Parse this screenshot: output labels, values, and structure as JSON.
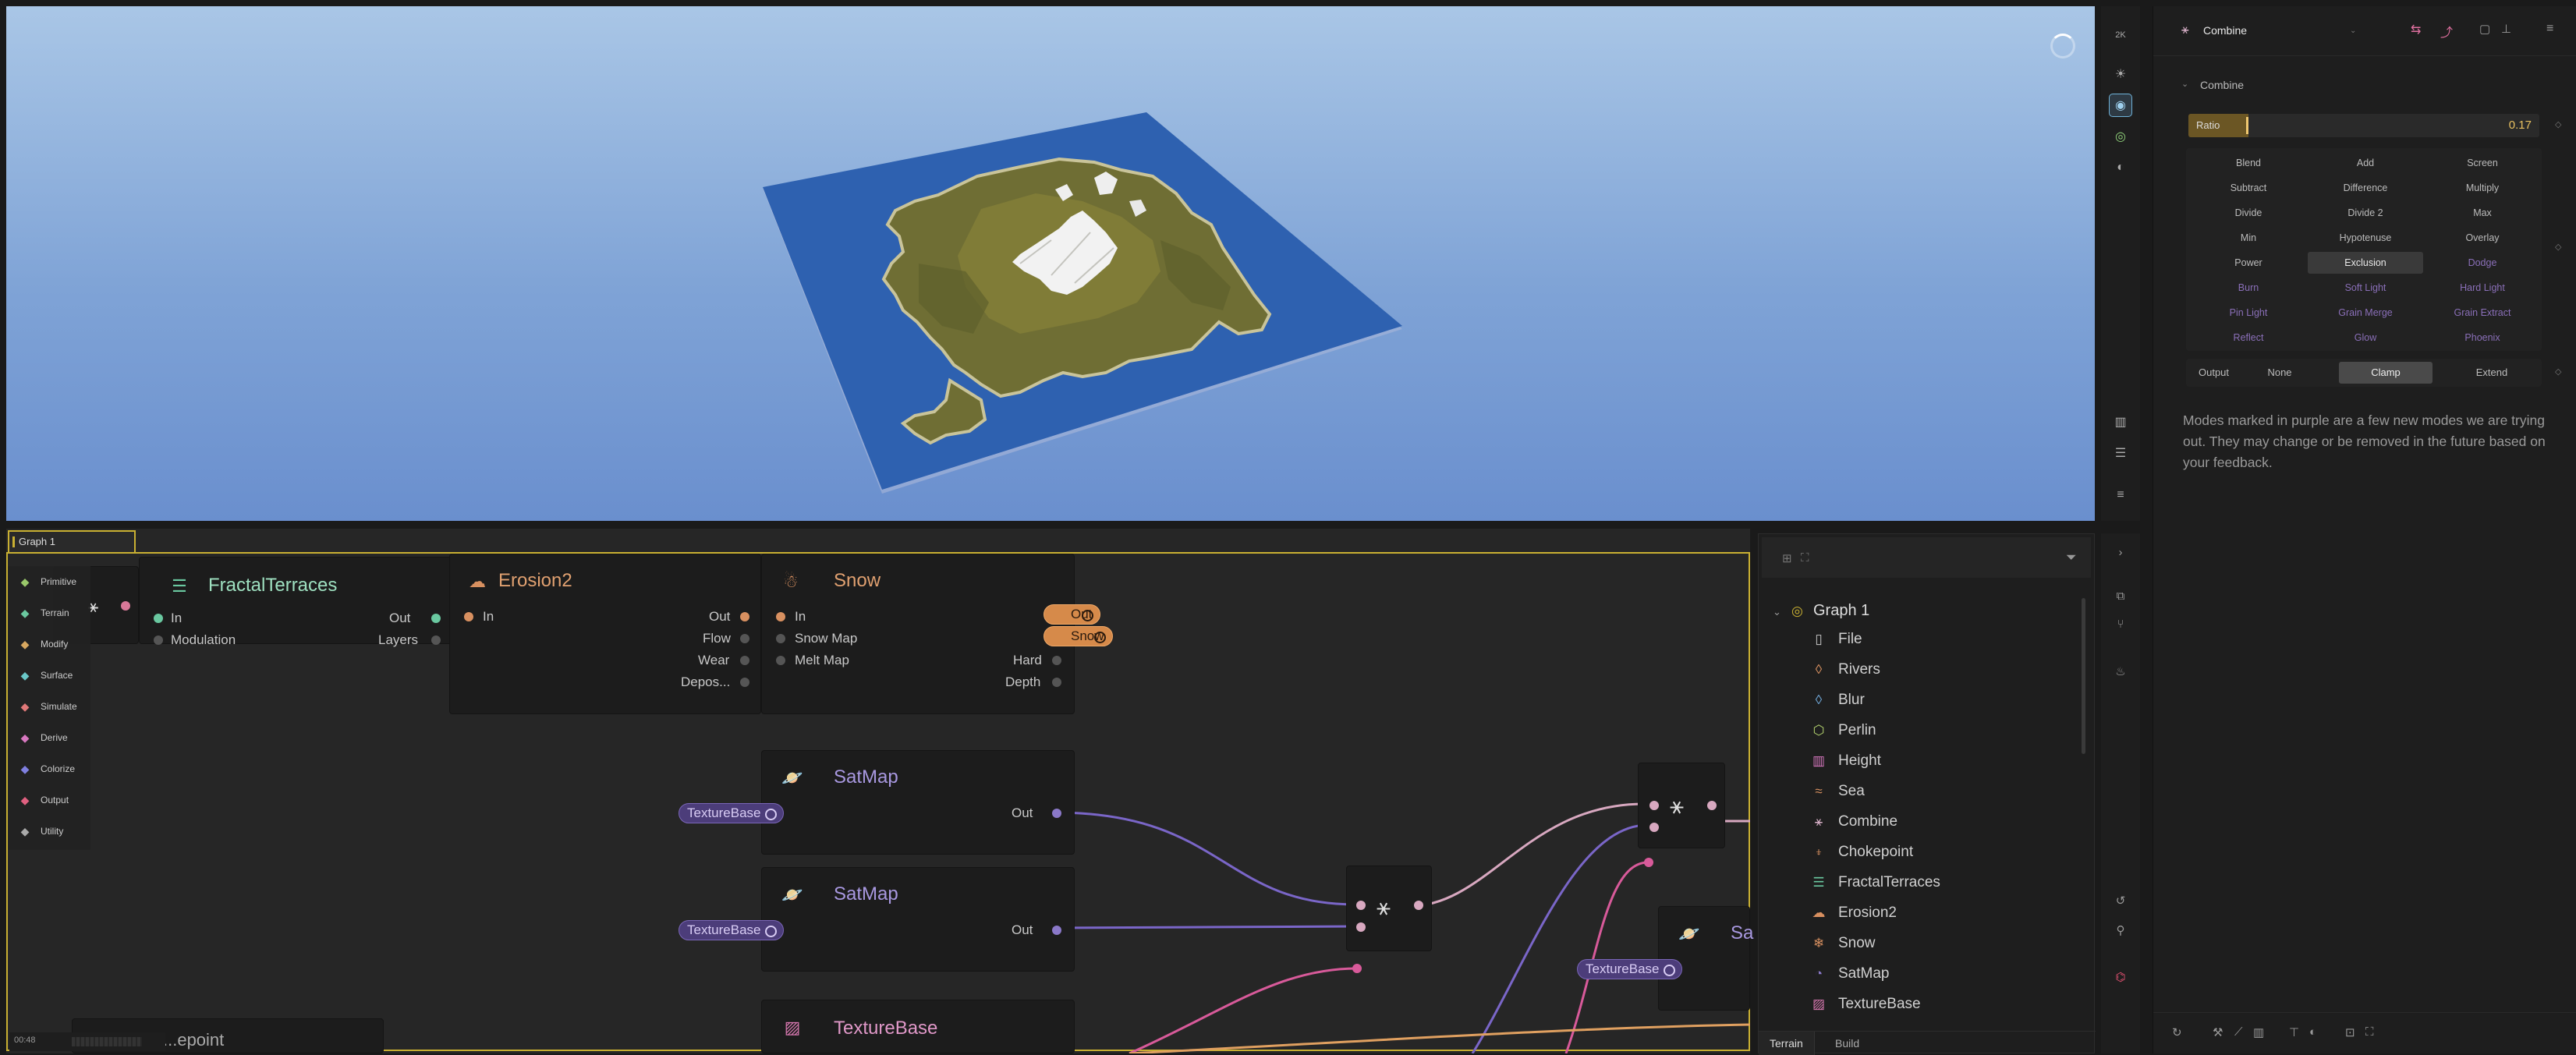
{
  "viewport": {
    "toolbar_badge": "2K",
    "colors": {
      "sky_top": "#a9c6e6",
      "sky_bottom": "#6a8fce",
      "water": "#2e61b0",
      "land": "#7e7a3a",
      "snow": "#f2f2f2"
    }
  },
  "properties": {
    "node_title": "Combine",
    "section_title": "Combine",
    "ratio": {
      "label": "Ratio",
      "value": "0.17",
      "fraction": 0.17
    },
    "modes": [
      [
        {
          "label": "Blend",
          "new": false
        },
        {
          "label": "Add",
          "new": false
        },
        {
          "label": "Screen",
          "new": false
        }
      ],
      [
        {
          "label": "Subtract",
          "new": false
        },
        {
          "label": "Difference",
          "new": false
        },
        {
          "label": "Multiply",
          "new": false
        }
      ],
      [
        {
          "label": "Divide",
          "new": false
        },
        {
          "label": "Divide 2",
          "new": false
        },
        {
          "label": "Max",
          "new": false
        }
      ],
      [
        {
          "label": "Min",
          "new": false
        },
        {
          "label": "Hypotenuse",
          "new": false
        },
        {
          "label": "Overlay",
          "new": false
        }
      ],
      [
        {
          "label": "Power",
          "new": false
        },
        {
          "label": "Exclusion",
          "new": false,
          "selected": true
        },
        {
          "label": "Dodge",
          "new": true
        }
      ],
      [
        {
          "label": "Burn",
          "new": true
        },
        {
          "label": "Soft Light",
          "new": true
        },
        {
          "label": "Hard Light",
          "new": true
        }
      ],
      [
        {
          "label": "Pin Light",
          "new": true
        },
        {
          "label": "Grain Merge",
          "new": true
        },
        {
          "label": "Grain Extract",
          "new": true
        }
      ],
      [
        {
          "label": "Reflect",
          "new": true
        },
        {
          "label": "Glow",
          "new": true
        },
        {
          "label": "Phoenix",
          "new": true
        }
      ]
    ],
    "output": {
      "label": "Output",
      "options": [
        "None",
        "Clamp",
        "Extend"
      ],
      "selected": "Clamp"
    },
    "note": "Modes marked in purple are a few new modes we are trying out. They may change or be removed in the future based on your feedback."
  },
  "graph": {
    "tab": "Graph 1",
    "categories": [
      {
        "label": "Primitive",
        "icon": "cube-icon",
        "color": "#9ac86a"
      },
      {
        "label": "Terrain",
        "icon": "mountain-icon",
        "color": "#6ac8a0"
      },
      {
        "label": "Modify",
        "icon": "wrench-icon",
        "color": "#d8a860"
      },
      {
        "label": "Surface",
        "icon": "layers-icon",
        "color": "#6ac8c8"
      },
      {
        "label": "Simulate",
        "icon": "drop-icon",
        "color": "#e07878"
      },
      {
        "label": "Derive",
        "icon": "branch-icon",
        "color": "#d878c0"
      },
      {
        "label": "Colorize",
        "icon": "palette-icon",
        "color": "#8080e0"
      },
      {
        "label": "Output",
        "icon": "export-icon",
        "color": "#e06080"
      },
      {
        "label": "Utility",
        "icon": "tool-icon",
        "color": "#aaaaaa"
      }
    ],
    "nodes": {
      "fractal": {
        "title": "FractalTerraces",
        "in": "In",
        "modulation": "Modulation",
        "out": "Out",
        "layers": "Layers"
      },
      "erosion": {
        "title": "Erosion2",
        "in": "In",
        "out": "Out",
        "flow": "Flow",
        "wear": "Wear",
        "deposits": "Depos..."
      },
      "snow": {
        "title": "Snow",
        "in": "In",
        "snow_map": "Snow Map",
        "melt_map": "Melt Map",
        "hard": "Hard",
        "depth": "Depth",
        "tag_out": "Out",
        "tag_snow": "Snow"
      },
      "satmap1": {
        "title": "SatMap",
        "out": "Out",
        "input_tag": "TextureBase"
      },
      "satmap2": {
        "title": "SatMap",
        "out": "Out",
        "input_tag": "TextureBase"
      },
      "texturebase": {
        "title": "TextureBase"
      },
      "satmap3": {
        "title": "Sa",
        "input_tag": "TextureBase"
      },
      "partial": {
        "title": "...epoint"
      }
    },
    "status": "00:48"
  },
  "tree": {
    "root": "Graph 1",
    "items": [
      {
        "label": "File",
        "icon": "file-icon",
        "color": "#c8c8c8"
      },
      {
        "label": "Rivers",
        "icon": "drop-icon",
        "color": "#d89060"
      },
      {
        "label": "Blur",
        "icon": "drop-icon",
        "color": "#70a8d8"
      },
      {
        "label": "Perlin",
        "icon": "hex-icon",
        "color": "#b8d870"
      },
      {
        "label": "Height",
        "icon": "bars-icon",
        "color": "#d878c0"
      },
      {
        "label": "Sea",
        "icon": "wave-icon",
        "color": "#d89060"
      },
      {
        "label": "Combine",
        "icon": "combine-icon",
        "color": "#d8b0c8"
      },
      {
        "label": "Chokepoint",
        "icon": "pin-icon",
        "color": "#d89060"
      },
      {
        "label": "FractalTerraces",
        "icon": "terraces-icon",
        "color": "#6ac8a0"
      },
      {
        "label": "Erosion2",
        "icon": "cloud-icon",
        "color": "#d89060"
      },
      {
        "label": "Snow",
        "icon": "snow-icon",
        "color": "#d89060"
      },
      {
        "label": "SatMap",
        "icon": "planet-icon",
        "color": "#8a78c8"
      },
      {
        "label": "TextureBase",
        "icon": "hatch-icon",
        "color": "#d878b0"
      }
    ],
    "tabs": [
      "Terrain",
      "Build"
    ]
  }
}
